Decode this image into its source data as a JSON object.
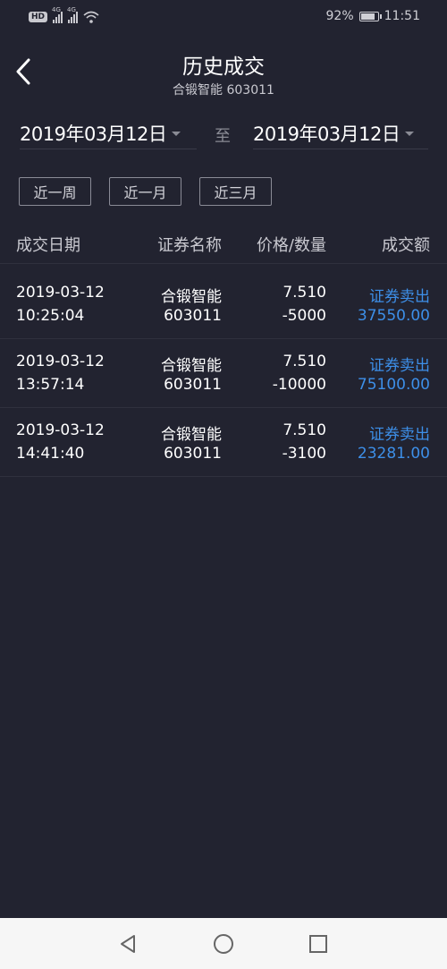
{
  "status": {
    "network_badge": "HD",
    "sig1_label": "4G",
    "sig2_label": "4G",
    "battery_pct": "92%",
    "battery_level": 0.92,
    "time": "11:51"
  },
  "header": {
    "title": "历史成交",
    "subtitle": "合锻智能 603011"
  },
  "filter": {
    "date_from": "2019年03月12日",
    "to_label": "至",
    "date_to": "2019年03月12日",
    "quick": [
      "近一周",
      "近一月",
      "近三月"
    ]
  },
  "table": {
    "headers": {
      "date": "成交日期",
      "name": "证券名称",
      "price_qty": "价格/数量",
      "amount": "成交额"
    },
    "rows": [
      {
        "date": "2019-03-12",
        "time": "10:25:04",
        "name": "合锻智能",
        "code": "603011",
        "price": "7.510",
        "qty": "-5000",
        "type": "证券卖出",
        "amount": "37550.00"
      },
      {
        "date": "2019-03-12",
        "time": "13:57:14",
        "name": "合锻智能",
        "code": "603011",
        "price": "7.510",
        "qty": "-10000",
        "type": "证券卖出",
        "amount": "75100.00"
      },
      {
        "date": "2019-03-12",
        "time": "14:41:40",
        "name": "合锻智能",
        "code": "603011",
        "price": "7.510",
        "qty": "-3100",
        "type": "证券卖出",
        "amount": "23281.00"
      }
    ]
  },
  "colors": {
    "background": "#222330",
    "accent": "#3d8fe8",
    "nav_bar": "#f6f6f6"
  },
  "icons": {
    "back": "chevron-left-icon",
    "nav_back": "triangle-back-icon",
    "nav_home": "circle-home-icon",
    "nav_recent": "square-recent-icon"
  }
}
